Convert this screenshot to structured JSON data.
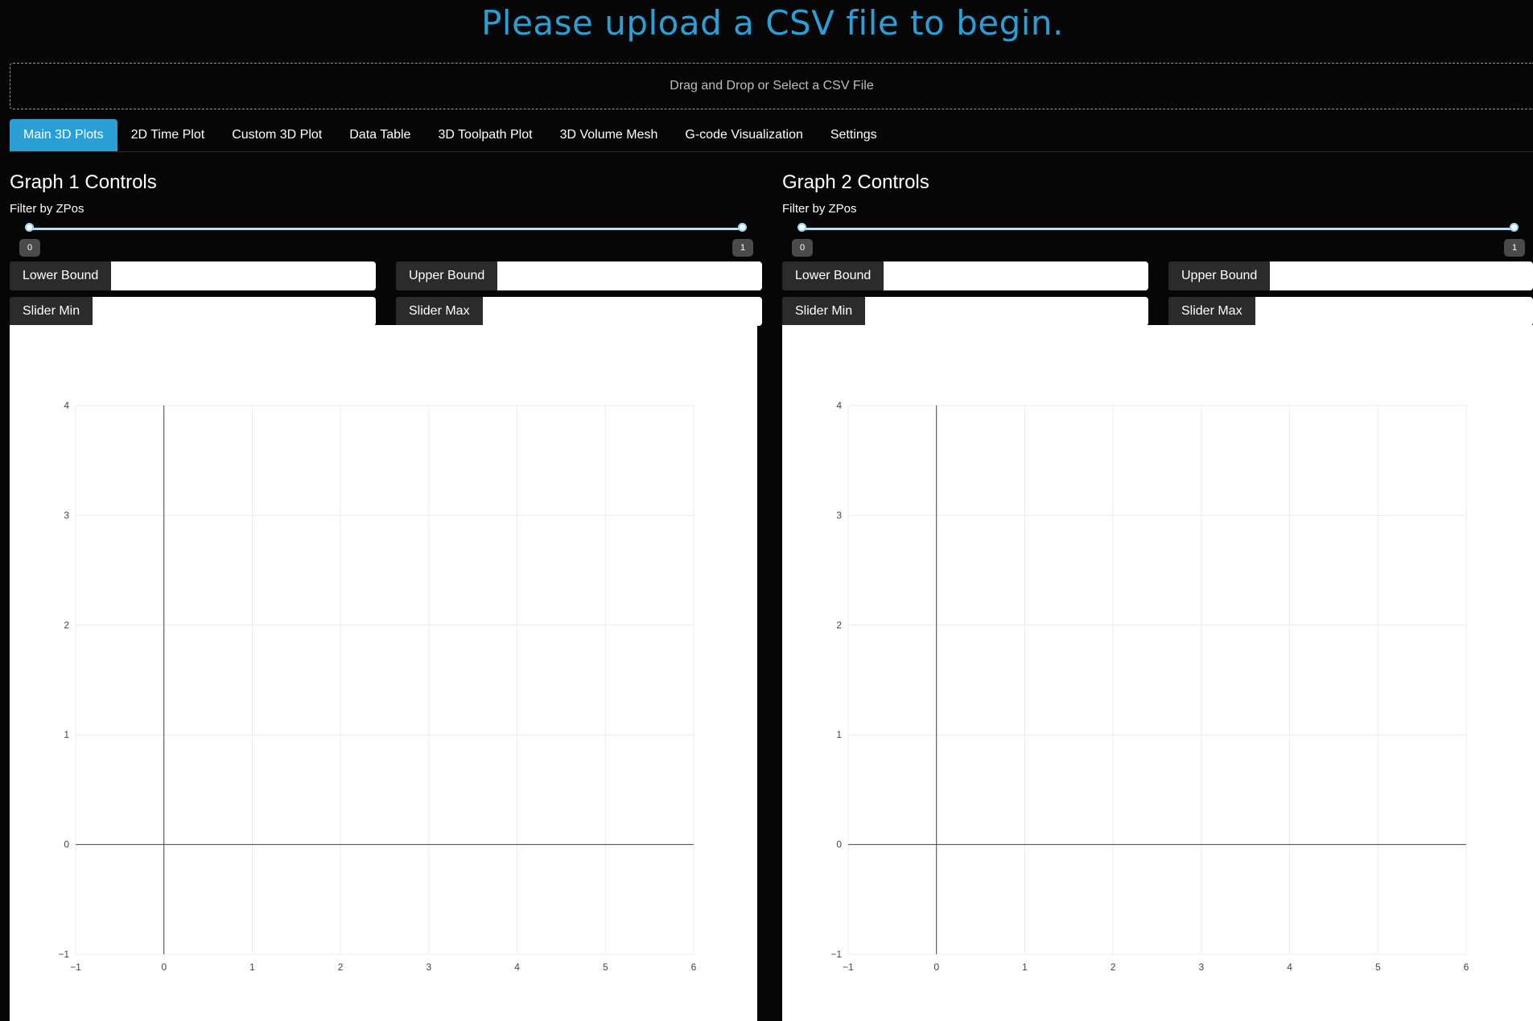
{
  "page": {
    "title": "Please upload a CSV file to begin.",
    "upload_text": "Drag and Drop or Select a CSV File",
    "accent_color": "#2a9fd6"
  },
  "tabs": [
    {
      "label": "Main 3D Plots",
      "active": true
    },
    {
      "label": "2D Time Plot",
      "active": false
    },
    {
      "label": "Custom 3D Plot",
      "active": false
    },
    {
      "label": "Data Table",
      "active": false
    },
    {
      "label": "3D Toolpath Plot",
      "active": false
    },
    {
      "label": "3D Volume Mesh",
      "active": false
    },
    {
      "label": "G-code Visualization",
      "active": false
    },
    {
      "label": "Settings",
      "active": false
    }
  ],
  "graphs": [
    {
      "controls_title": "Graph 1 Controls",
      "filter_label": "Filter by ZPos",
      "slider_min_value": "0",
      "slider_max_value": "1",
      "lower_bound_label": "Lower Bound",
      "upper_bound_label": "Upper Bound",
      "slider_min_label": "Slider Min",
      "slider_max_label": "Slider Max"
    },
    {
      "controls_title": "Graph 2 Controls",
      "filter_label": "Filter by ZPos",
      "slider_min_value": "0",
      "slider_max_value": "1",
      "lower_bound_label": "Lower Bound",
      "upper_bound_label": "Upper Bound",
      "slider_min_label": "Slider Min",
      "slider_max_label": "Slider Max"
    }
  ],
  "chart_data": [
    {
      "type": "scatter",
      "series": [],
      "xlim": [
        -1,
        6
      ],
      "ylim": [
        -1,
        4
      ],
      "x_ticks": [
        "−1",
        "0",
        "1",
        "2",
        "3",
        "4",
        "5",
        "6"
      ],
      "y_ticks": [
        "−1",
        "0",
        "1",
        "2",
        "3",
        "4"
      ],
      "grid": true
    },
    {
      "type": "scatter",
      "series": [],
      "xlim": [
        -1,
        6
      ],
      "ylim": [
        -1,
        4
      ],
      "x_ticks": [
        "−1",
        "0",
        "1",
        "2",
        "3",
        "4",
        "5",
        "6"
      ],
      "y_ticks": [
        "−1",
        "0",
        "1",
        "2",
        "3",
        "4"
      ],
      "grid": true
    }
  ]
}
